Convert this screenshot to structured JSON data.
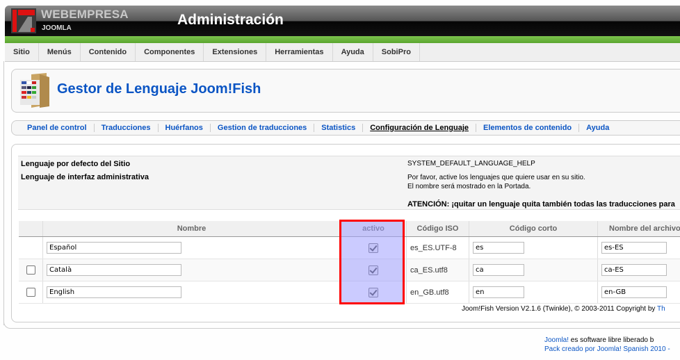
{
  "header": {
    "brand_line1": "WEBEMPRESA",
    "brand_line2": "JOOMLA",
    "title": "Administración",
    "accent_color": "#6bb53e"
  },
  "menu": {
    "items": [
      {
        "label": "Sitio"
      },
      {
        "label": "Menús"
      },
      {
        "label": "Contenido"
      },
      {
        "label": "Componentes"
      },
      {
        "label": "Extensiones"
      },
      {
        "label": "Herramientas"
      },
      {
        "label": "Ayuda"
      },
      {
        "label": "SobiPro"
      }
    ]
  },
  "page": {
    "title": "Gestor de Lenguaje Joom!Fish",
    "icon": "language-folder-icon"
  },
  "submenu": {
    "items": [
      {
        "label": "Panel de control",
        "active": false
      },
      {
        "label": "Traducciones",
        "active": false
      },
      {
        "label": "Huérfanos",
        "active": false
      },
      {
        "label": "Gestion de traducciones",
        "active": false
      },
      {
        "label": "Statistics",
        "active": false
      },
      {
        "label": "Configuración de Lenguaje",
        "active": true
      },
      {
        "label": "Elementos de contenido",
        "active": false
      },
      {
        "label": "Ayuda",
        "active": false
      }
    ]
  },
  "config": {
    "default_site_label": "Lenguaje por defecto del Sitio",
    "default_site_help": "SYSTEM_DEFAULT_LANGUAGE_HELP",
    "admin_interface_label": "Lenguaje de interfaz administrativa",
    "instructions_line1": "Por favor, active los lenguajes que quiere usar en su sitio.",
    "instructions_line2": "El nombre será mostrado en la Portada.",
    "warning": "ATENCIÓN: ¡quitar un lenguaje quita también todas las traducciones para"
  },
  "languages": {
    "headers": {
      "name": "Nombre",
      "active": "activo",
      "iso": "Código ISO",
      "short": "Código corto",
      "file": "Nombre del archivo"
    },
    "rows": [
      {
        "selectable": false,
        "selected": false,
        "name": "Español",
        "active": true,
        "iso": "es_ES.UTF-8",
        "short": "es",
        "file": "es-ES"
      },
      {
        "selectable": true,
        "selected": false,
        "name": "Català",
        "active": true,
        "iso": "ca_ES.utf8",
        "short": "ca",
        "file": "ca-ES"
      },
      {
        "selectable": true,
        "selected": false,
        "name": "English",
        "active": true,
        "iso": "en_GB.utf8",
        "short": "en",
        "file": "en-GB"
      }
    ],
    "highlight_color": "#ff0000"
  },
  "version": {
    "text": "Joom!Fish Version V2.1.6 (Twinkle), © 2003-2011 Copyright by ",
    "link": "Th"
  },
  "footer": {
    "joomla_link": "Joomla!",
    "line1_text": " es software libre liberado b",
    "line2": "Pack creado por Joomla! Spanish 2010 -"
  }
}
